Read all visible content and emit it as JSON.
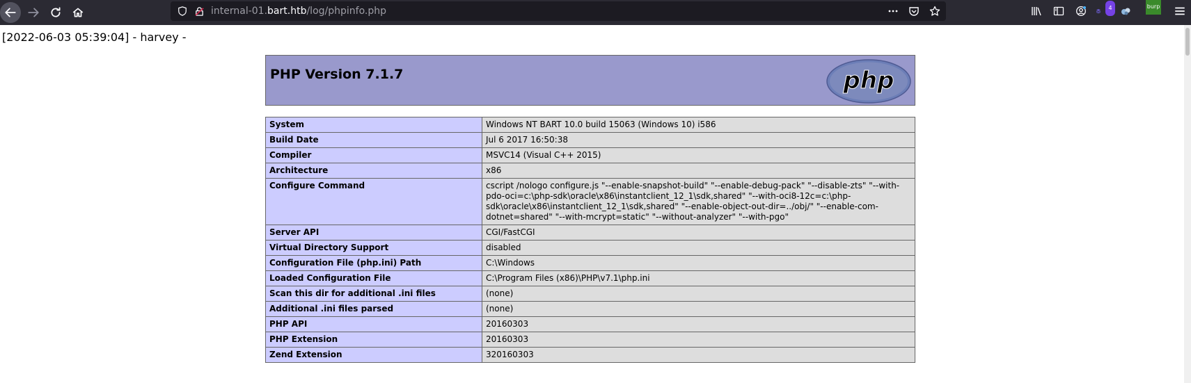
{
  "browser": {
    "url_prefix": "internal-01.",
    "url_host": "bart.htb",
    "url_path": "/log/phpinfo.php",
    "extension_badge": "4",
    "burp_label": "burp"
  },
  "page": {
    "log_line": "[2022-06-03 05:39:04] - harvey -",
    "php_title": "PHP Version 7.1.7",
    "logo_text": "php"
  },
  "rows": [
    {
      "key": "System",
      "value": "Windows NT BART 10.0 build 15063 (Windows 10) i586"
    },
    {
      "key": "Build Date",
      "value": "Jul 6 2017 16:50:38"
    },
    {
      "key": "Compiler",
      "value": "MSVC14 (Visual C++ 2015)"
    },
    {
      "key": "Architecture",
      "value": "x86"
    },
    {
      "key": "Configure Command",
      "value": "cscript /nologo configure.js \"--enable-snapshot-build\" \"--enable-debug-pack\" \"--disable-zts\" \"--with-pdo-oci=c:\\php-sdk\\oracle\\x86\\instantclient_12_1\\sdk,shared\" \"--with-oci8-12c=c:\\php-sdk\\oracle\\x86\\instantclient_12_1\\sdk,shared\" \"--enable-object-out-dir=../obj/\" \"--enable-com-dotnet=shared\" \"--with-mcrypt=static\" \"--without-analyzer\" \"--with-pgo\""
    },
    {
      "key": "Server API",
      "value": "CGI/FastCGI"
    },
    {
      "key": "Virtual Directory Support",
      "value": "disabled"
    },
    {
      "key": "Configuration File (php.ini) Path",
      "value": "C:\\Windows"
    },
    {
      "key": "Loaded Configuration File",
      "value": "C:\\Program Files (x86)\\PHP\\v7.1\\php.ini"
    },
    {
      "key": "Scan this dir for additional .ini files",
      "value": "(none)"
    },
    {
      "key": "Additional .ini files parsed",
      "value": "(none)"
    },
    {
      "key": "PHP API",
      "value": "20160303"
    },
    {
      "key": "PHP Extension",
      "value": "20160303"
    },
    {
      "key": "Zend Extension",
      "value": "320160303"
    }
  ]
}
